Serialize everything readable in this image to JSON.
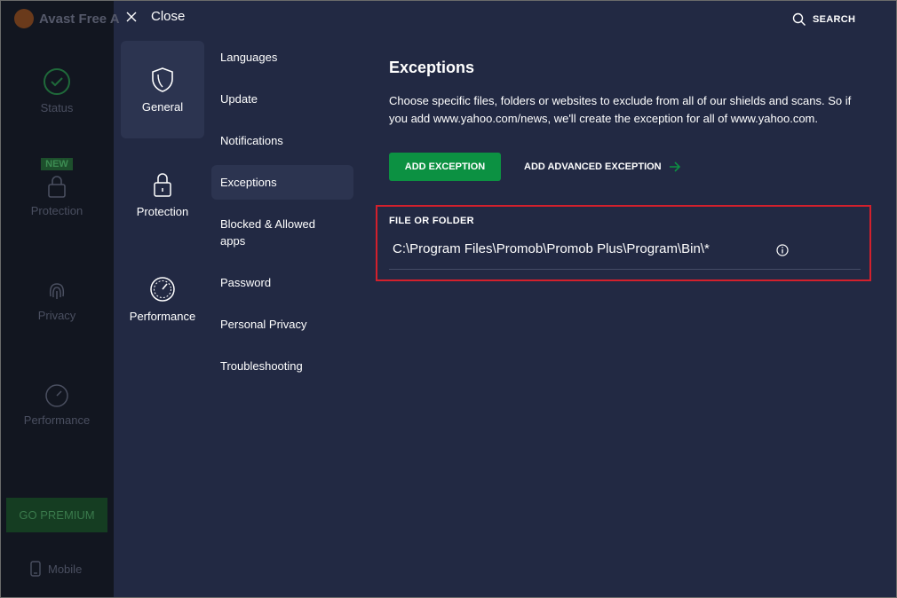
{
  "background_app": {
    "title": "Avast Free A",
    "nav": [
      {
        "label": "Status",
        "icon": "check-circle-icon"
      },
      {
        "label": "Protection",
        "icon": "lock-icon",
        "badge": "NEW"
      },
      {
        "label": "Privacy",
        "icon": "fingerprint-icon"
      },
      {
        "label": "Performance",
        "icon": "speedometer-icon"
      }
    ],
    "premium_label": "GO PREMIUM",
    "mobile_label": "Mobile"
  },
  "topbar": {
    "close_label": "Close",
    "search_label": "SEARCH"
  },
  "categories": [
    {
      "label": "General",
      "icon": "shield-icon",
      "active": true
    },
    {
      "label": "Protection",
      "icon": "lock-icon",
      "active": false
    },
    {
      "label": "Performance",
      "icon": "speedometer-icon",
      "active": false
    }
  ],
  "subnav": [
    {
      "label": "Languages"
    },
    {
      "label": "Update"
    },
    {
      "label": "Notifications"
    },
    {
      "label": "Exceptions",
      "active": true
    },
    {
      "label": "Blocked & Allowed apps"
    },
    {
      "label": "Password"
    },
    {
      "label": "Personal Privacy"
    },
    {
      "label": "Troubleshooting"
    }
  ],
  "main": {
    "heading": "Exceptions",
    "description": "Choose specific files, folders or websites to exclude from all of our shields and scans. So if you add www.yahoo.com/news, we'll create the exception for all of www.yahoo.com.",
    "add_button": "ADD EXCEPTION",
    "advanced_button": "ADD ADVANCED EXCEPTION",
    "field_label": "FILE OR FOLDER",
    "field_value": "C:\\Program Files\\Promob\\Promob Plus\\Program\\Bin\\*"
  },
  "colors": {
    "background": "#222943",
    "sidebar_dim": "#121620",
    "active_item": "#2c3450",
    "accent_green": "#0c9142",
    "highlight_red": "#d3202c"
  }
}
